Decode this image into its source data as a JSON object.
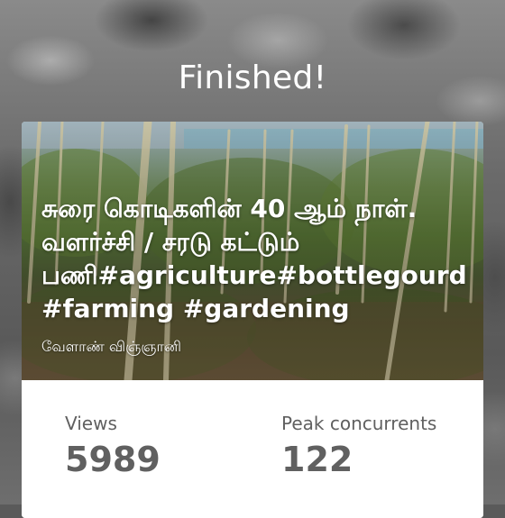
{
  "header": {
    "title": "Finished!"
  },
  "video": {
    "title": "சுரை கொடிகளின் 40 ஆம் நாள். வளர்ச்சி / சரடு கட்டும் பணி#agriculture#bottlegourd #farming #gardening",
    "author": "வேளாண் விஞ்ஞானி"
  },
  "stats": {
    "views": {
      "label": "Views",
      "value": "5989"
    },
    "peak": {
      "label": "Peak concurrents",
      "value": "122"
    }
  }
}
